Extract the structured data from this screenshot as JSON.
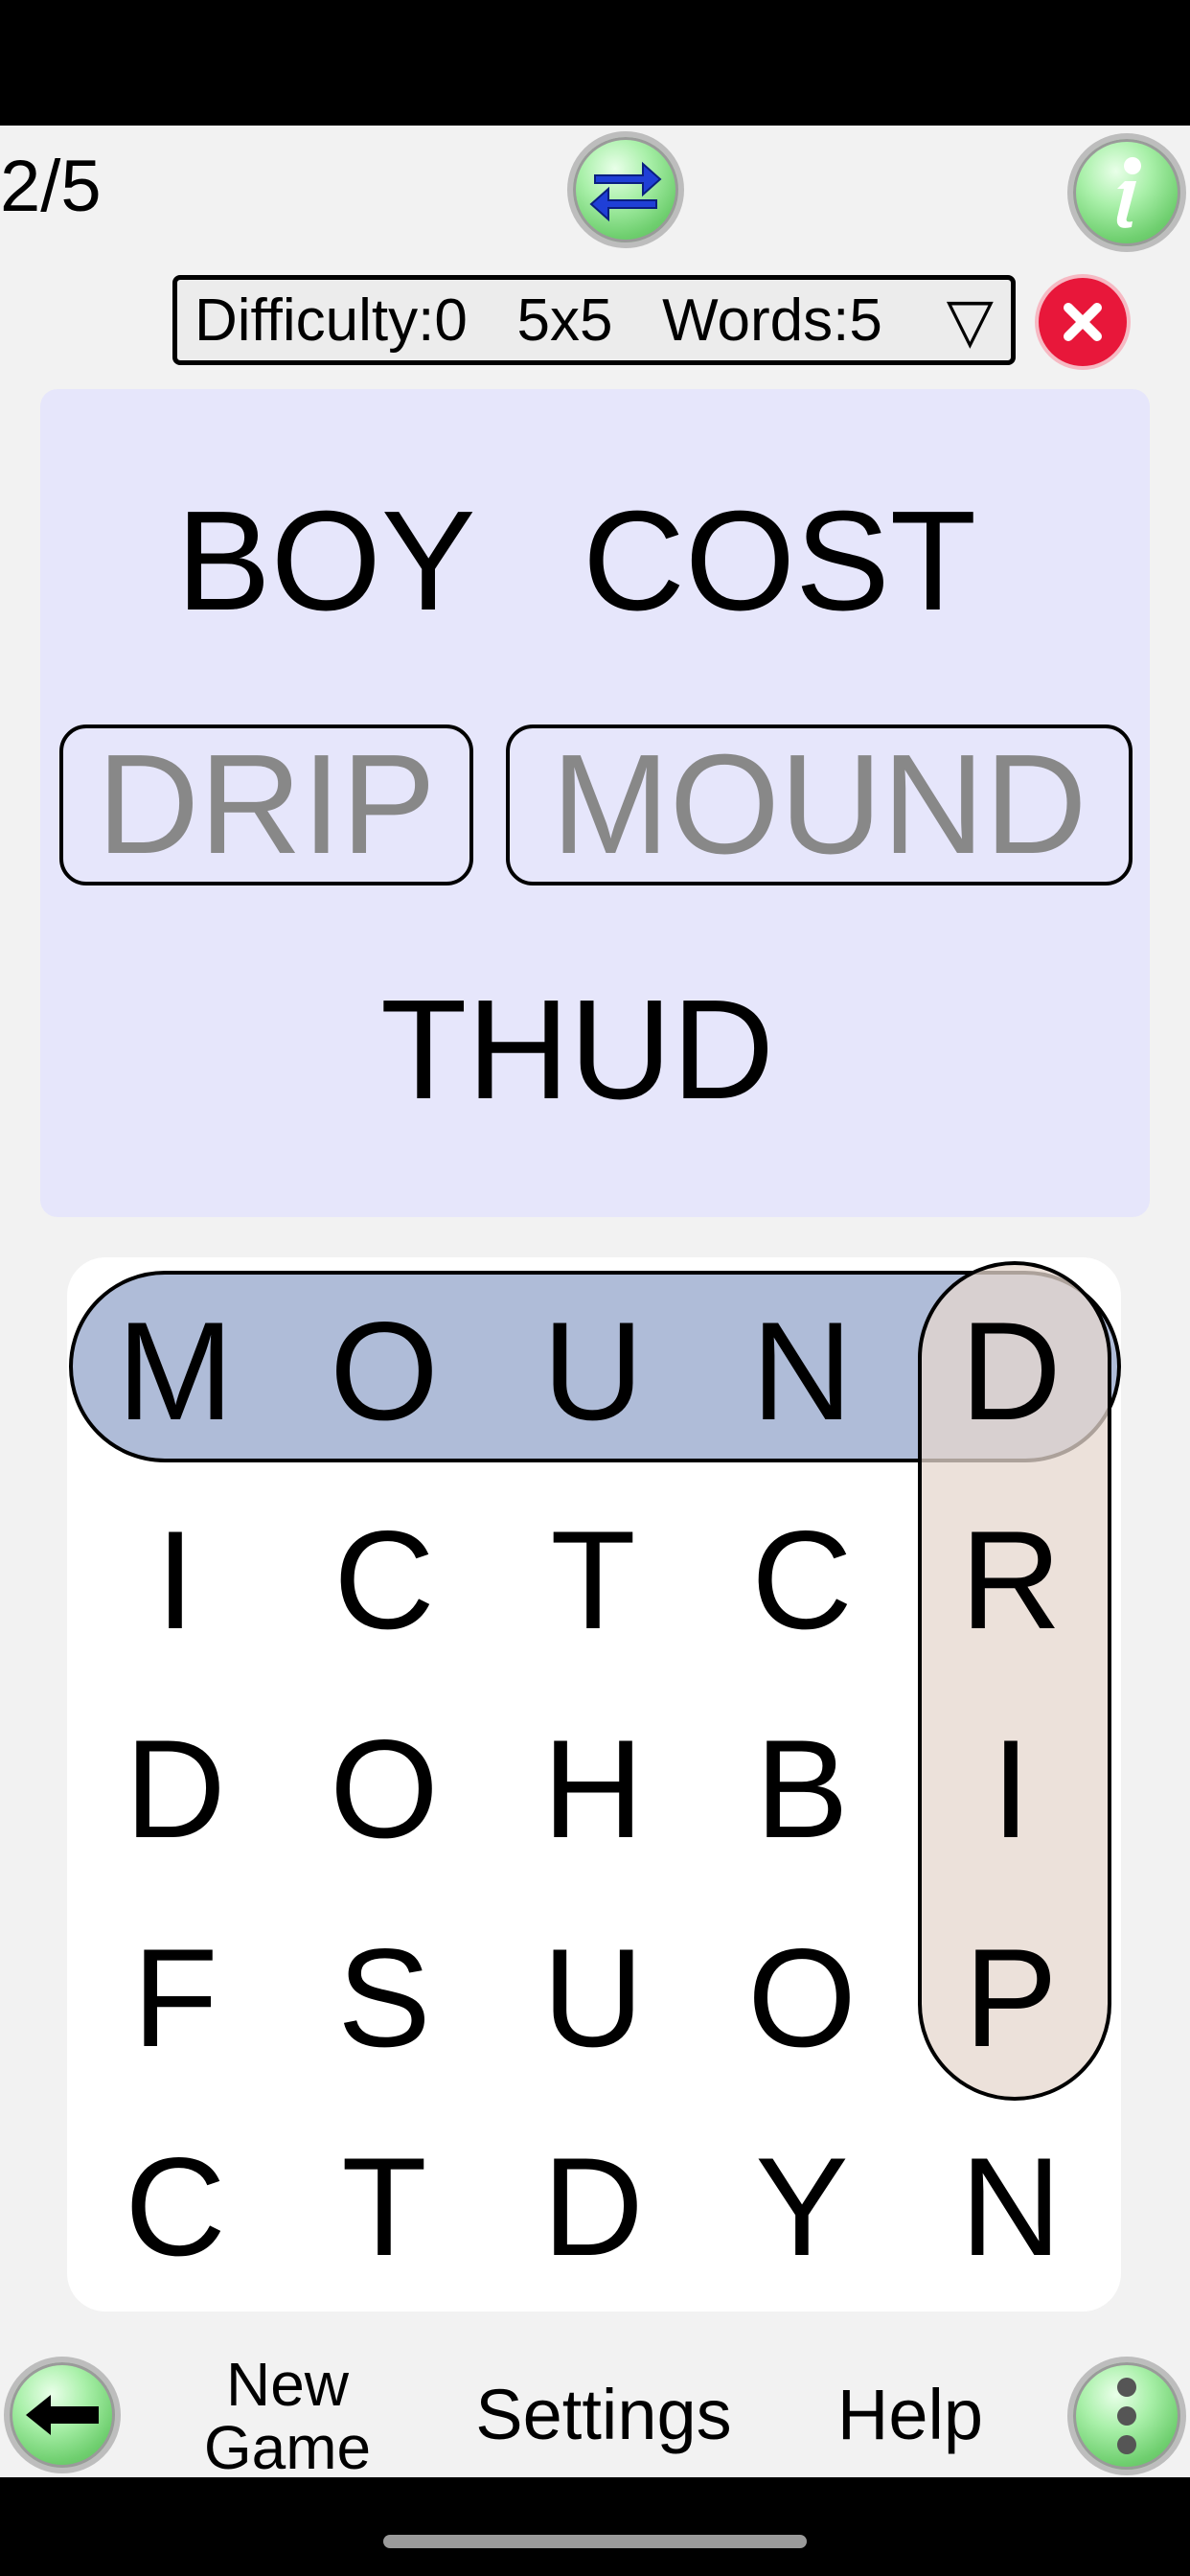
{
  "header": {
    "progress": "2/5",
    "difficulty_label": "Difficulty:0   5x5   Words:5",
    "dropdown_arrow": "▽"
  },
  "words": {
    "boy": "BOY",
    "cost": "COST",
    "drip": "DRIP",
    "mound": "MOUND",
    "thud": "THUD"
  },
  "grid": {
    "rows": [
      [
        "M",
        "O",
        "U",
        "N",
        "D"
      ],
      [
        "I",
        "C",
        "T",
        "C",
        "R"
      ],
      [
        "D",
        "O",
        "H",
        "B",
        "I"
      ],
      [
        "F",
        "S",
        "U",
        "O",
        "P"
      ],
      [
        "C",
        "T",
        "D",
        "Y",
        "N"
      ]
    ]
  },
  "nav": {
    "new_game_line1": "New",
    "new_game_line2": "Game",
    "settings": "Settings",
    "help": "Help"
  },
  "icons": {
    "swap": "swap-arrows-icon",
    "info": "info-icon",
    "close": "close-icon",
    "back": "back-arrow-icon",
    "menu": "more-vertical-icon"
  },
  "colors": {
    "words_panel_bg": "#e6e6fb",
    "found_row_highlight": "#afbcd8",
    "found_col_highlight": "#e6d7cd",
    "found_word_text": "#888888",
    "close_red": "#e8173a",
    "button_green": "#6fcf6f"
  }
}
